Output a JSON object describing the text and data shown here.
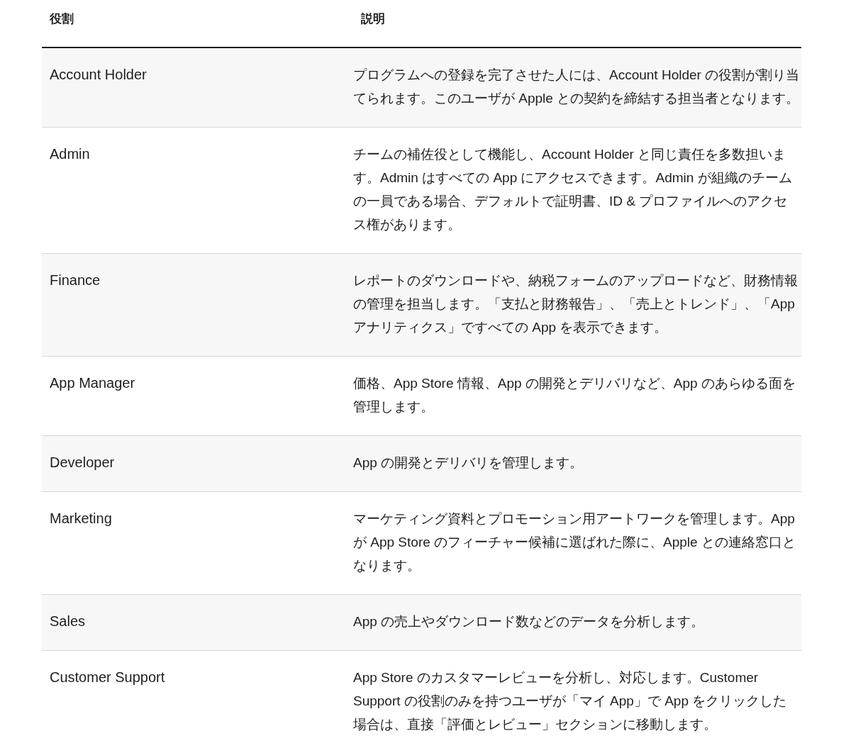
{
  "table": {
    "columns": [
      "役割",
      "説明"
    ],
    "rows": [
      {
        "role": "Account Holder",
        "description": "プログラムへの登録を完了させた人には、Account Holder の役割が割り当てられます。このユーザが Apple との契約を締結する担当者となります。"
      },
      {
        "role": "Admin",
        "description": "チームの補佐役として機能し、Account Holder と同じ責任を多数担います。Admin はすべての App にアクセスできます。Admin が組織のチームの一員である場合、デフォルトで証明書、ID & プロファイルへのアクセス権があります。"
      },
      {
        "role": "Finance",
        "description": "レポートのダウンロードや、納税フォームのアップロードなど、財務情報の管理を担当します。「支払と財務報告」、「売上とトレンド」、「App アナリティクス」ですべての App を表示できます。"
      },
      {
        "role": "App Manager",
        "description": "価格、App Store 情報、App の開発とデリバリなど、App のあらゆる面を管理します。"
      },
      {
        "role": "Developer",
        "description": "App の開発とデリバリを管理します。"
      },
      {
        "role": "Marketing",
        "description": "マーケティング資料とプロモーション用アートワークを管理します。App が App Store のフィーチャー候補に選ばれた際に、Apple との連絡窓口となります。"
      },
      {
        "role": "Sales",
        "description": "App の売上やダウンロード数などのデータを分析します。"
      },
      {
        "role": "Customer Support",
        "description": "App Store のカスタマーレビューを分析し、対応します。Customer Support の役割のみを持つユーザが「マイ App」で App をクリックした場合は、直接「評価とレビュー」セクションに移動します。"
      }
    ]
  }
}
